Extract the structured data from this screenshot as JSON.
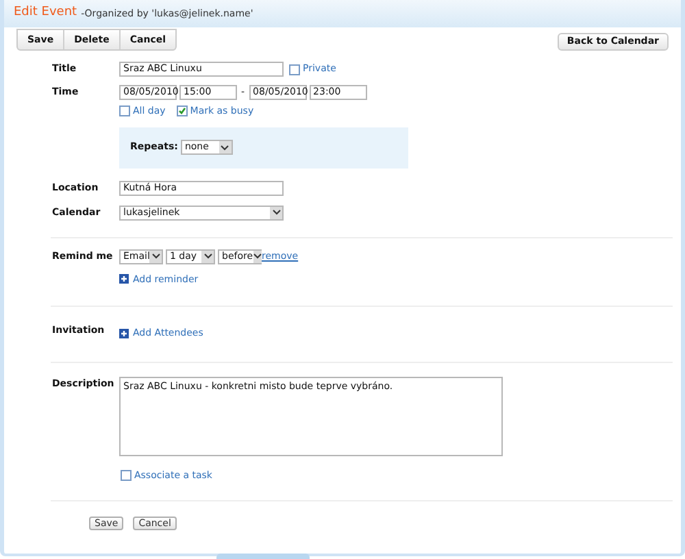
{
  "header": {
    "title": "Edit Event",
    "organizer": "-Organized by 'lukas@jelinek.name'"
  },
  "toolbar": {
    "buttons": [
      "Save",
      "Delete",
      "Cancel"
    ],
    "back": "Back to Calendar"
  },
  "title": {
    "label": "Title",
    "value": "Sraz ABC Linuxu",
    "private": {
      "label": "Private",
      "checked": false
    }
  },
  "time": {
    "label": "Time",
    "start_date": "08/05/2010",
    "start_time": "15:00",
    "separator": "-",
    "end_date": "08/05/2010",
    "end_time": "23:00",
    "options": [
      {
        "label": "All day",
        "checked": false
      },
      {
        "label": "Mark as busy",
        "checked": true
      }
    ]
  },
  "repeats": {
    "label": "Repeats:",
    "value": "none"
  },
  "location": {
    "label": "Location",
    "value": "Kutná Hora"
  },
  "calendar": {
    "label": "Calendar",
    "value": "lukasjelinek"
  },
  "remind": {
    "label": "Remind me",
    "method": "Email",
    "amount": "1 day",
    "when": "before",
    "remove": "remove",
    "add": "Add reminder"
  },
  "invitation": {
    "label": "Invitation",
    "add": "Add Attendees"
  },
  "description": {
    "label": "Description",
    "value": "Sraz ABC Linuxu - konkretni misto bude teprve vybráno.",
    "associate": {
      "label": "Associate a task",
      "checked": false
    }
  },
  "footer": {
    "buttons": [
      "Save",
      "Cancel"
    ]
  }
}
